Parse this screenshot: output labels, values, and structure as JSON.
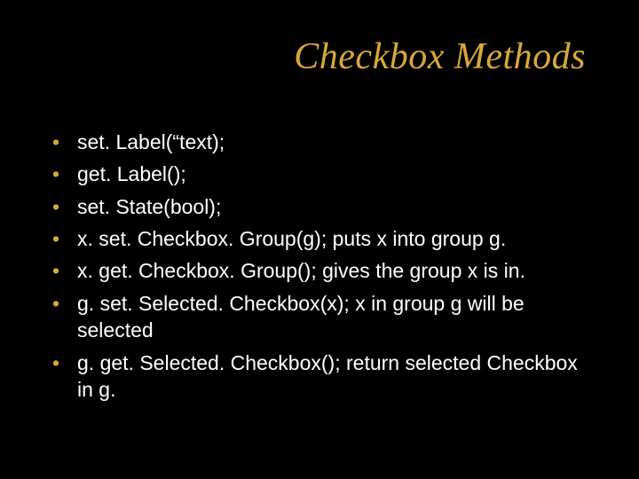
{
  "slide": {
    "title": "Checkbox Methods",
    "bullets": [
      "set. Label(“text);",
      "get. Label();",
      "set. State(bool);",
      "x. set. Checkbox. Group(g); puts x into group g.",
      "x. get. Checkbox. Group();  gives the group x is in.",
      "g. set. Selected. Checkbox(x); x in group g will be selected",
      "g. get. Selected. Checkbox(); return selected Checkbox in g."
    ]
  }
}
